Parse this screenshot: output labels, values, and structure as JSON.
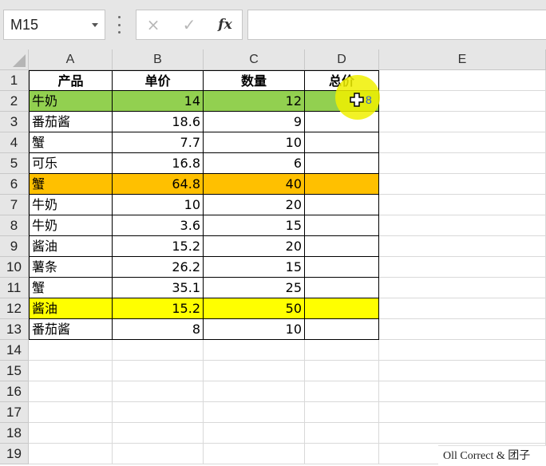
{
  "formula_bar": {
    "name_box": "M15",
    "cancel_icon": "×",
    "enter_icon": "✓",
    "function_icon": "fx",
    "formula": ""
  },
  "columns": [
    "A",
    "B",
    "C",
    "D",
    "E"
  ],
  "header": {
    "row_num": "1",
    "a": "产品",
    "b": "单价",
    "c": "数量",
    "d": "总价"
  },
  "rows": [
    {
      "num": "2",
      "product": "牛奶",
      "price": "14",
      "qty": "12",
      "total": "",
      "fill": "#92d050"
    },
    {
      "num": "3",
      "product": "番茄酱",
      "price": "18.6",
      "qty": "9",
      "total": ""
    },
    {
      "num": "4",
      "product": "蟹",
      "price": "7.7",
      "qty": "10",
      "total": ""
    },
    {
      "num": "5",
      "product": "可乐",
      "price": "16.8",
      "qty": "6",
      "total": ""
    },
    {
      "num": "6",
      "product": "蟹",
      "price": "64.8",
      "qty": "40",
      "total": "",
      "fill": "#ffc000"
    },
    {
      "num": "7",
      "product": "牛奶",
      "price": "10",
      "qty": "20",
      "total": ""
    },
    {
      "num": "8",
      "product": "牛奶",
      "price": "3.6",
      "qty": "15",
      "total": ""
    },
    {
      "num": "9",
      "product": "酱油",
      "price": "15.2",
      "qty": "20",
      "total": ""
    },
    {
      "num": "10",
      "product": "薯条",
      "price": "26.2",
      "qty": "15",
      "total": ""
    },
    {
      "num": "11",
      "product": "蟹",
      "price": "35.1",
      "qty": "25",
      "total": ""
    },
    {
      "num": "12",
      "product": "酱油",
      "price": "15.2",
      "qty": "50",
      "total": "",
      "fill": "#ffff00"
    },
    {
      "num": "13",
      "product": "番茄酱",
      "price": "8",
      "qty": "10",
      "total": ""
    }
  ],
  "empty_rows": [
    "14",
    "15",
    "16",
    "17",
    "18",
    "19"
  ],
  "d2_partial": "8",
  "watermark": "Oll Correct & 团子",
  "colors": {
    "accent_green": "#92d050",
    "accent_orange": "#ffc000",
    "accent_yellow": "#ffff00",
    "cursor_highlight": "#f0f000"
  }
}
